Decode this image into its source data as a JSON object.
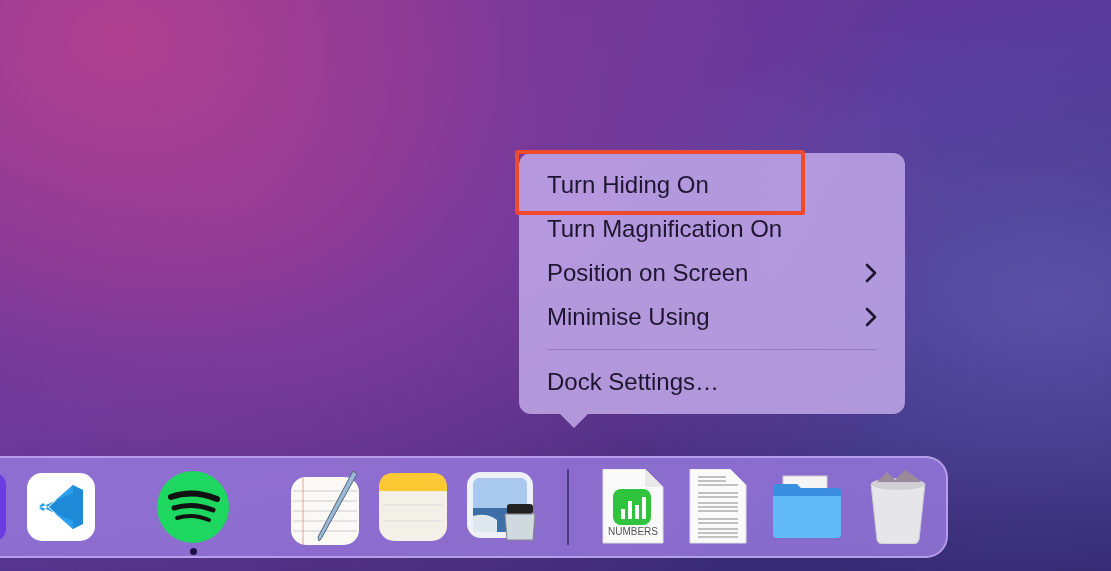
{
  "context_menu": {
    "items": [
      {
        "kind": "action",
        "label": "Turn Hiding On",
        "highlighted": true
      },
      {
        "kind": "action",
        "label": "Turn Magnification On",
        "highlighted": false
      },
      {
        "kind": "submenu",
        "label": "Position on Screen",
        "highlighted": false
      },
      {
        "kind": "submenu",
        "label": "Minimise Using",
        "highlighted": false
      },
      {
        "kind": "separator"
      },
      {
        "kind": "action",
        "label": "Dock Settings…",
        "highlighted": false
      }
    ]
  },
  "dock": {
    "items": [
      {
        "kind": "partial-app",
        "running": false
      },
      {
        "kind": "code-editor",
        "running": false
      },
      {
        "kind": "music",
        "running": true
      },
      {
        "kind": "text-editor",
        "running": false
      },
      {
        "kind": "notes",
        "running": false
      },
      {
        "kind": "preview",
        "running": false
      },
      {
        "kind": "separator"
      },
      {
        "kind": "spreadsheet-file",
        "label": "NUMBERS",
        "running": false
      },
      {
        "kind": "document",
        "running": false
      },
      {
        "kind": "folder",
        "running": false
      },
      {
        "kind": "trash",
        "running": false
      }
    ]
  }
}
